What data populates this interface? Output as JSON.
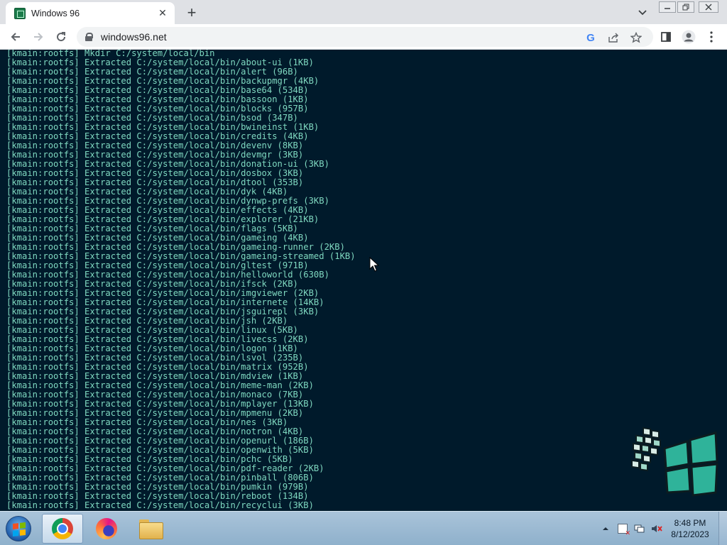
{
  "browser": {
    "tab": {
      "title": "Windows 96",
      "close": "✕"
    },
    "new_tab": "+",
    "address": {
      "url": "windows96.net"
    }
  },
  "terminal": {
    "colors": {
      "background": "#001a2b",
      "text": "#7fd8c0"
    },
    "lines": [
      "[kmain:rootfs] Mkdir C:/system/local/bin",
      "[kmain:rootfs] Extracted C:/system/local/bin/about-ui (1KB)",
      "[kmain:rootfs] Extracted C:/system/local/bin/alert (96B)",
      "[kmain:rootfs] Extracted C:/system/local/bin/backupmgr (4KB)",
      "[kmain:rootfs] Extracted C:/system/local/bin/base64 (534B)",
      "[kmain:rootfs] Extracted C:/system/local/bin/bassoon (1KB)",
      "[kmain:rootfs] Extracted C:/system/local/bin/blocks (957B)",
      "[kmain:rootfs] Extracted C:/system/local/bin/bsod (347B)",
      "[kmain:rootfs] Extracted C:/system/local/bin/bwineinst (1KB)",
      "[kmain:rootfs] Extracted C:/system/local/bin/credits (4KB)",
      "[kmain:rootfs] Extracted C:/system/local/bin/devenv (8KB)",
      "[kmain:rootfs] Extracted C:/system/local/bin/devmgr (3KB)",
      "[kmain:rootfs] Extracted C:/system/local/bin/donation-ui (3KB)",
      "[kmain:rootfs] Extracted C:/system/local/bin/dosbox (3KB)",
      "[kmain:rootfs] Extracted C:/system/local/bin/dtool (353B)",
      "[kmain:rootfs] Extracted C:/system/local/bin/dyk (4KB)",
      "[kmain:rootfs] Extracted C:/system/local/bin/dynwp-prefs (3KB)",
      "[kmain:rootfs] Extracted C:/system/local/bin/effects (4KB)",
      "[kmain:rootfs] Extracted C:/system/local/bin/explorer (21KB)",
      "[kmain:rootfs] Extracted C:/system/local/bin/flags (5KB)",
      "[kmain:rootfs] Extracted C:/system/local/bin/gameing (4KB)",
      "[kmain:rootfs] Extracted C:/system/local/bin/gameing-runner (2KB)",
      "[kmain:rootfs] Extracted C:/system/local/bin/gameing-streamed (1KB)",
      "[kmain:rootfs] Extracted C:/system/local/bin/gltest (971B)",
      "[kmain:rootfs] Extracted C:/system/local/bin/helloworld (630B)",
      "[kmain:rootfs] Extracted C:/system/local/bin/ifsck (2KB)",
      "[kmain:rootfs] Extracted C:/system/local/bin/imgviewer (2KB)",
      "[kmain:rootfs] Extracted C:/system/local/bin/internete (14KB)",
      "[kmain:rootfs] Extracted C:/system/local/bin/jsguirepl (3KB)",
      "[kmain:rootfs] Extracted C:/system/local/bin/jsh (2KB)",
      "[kmain:rootfs] Extracted C:/system/local/bin/linux (5KB)",
      "[kmain:rootfs] Extracted C:/system/local/bin/livecss (2KB)",
      "[kmain:rootfs] Extracted C:/system/local/bin/logon (1KB)",
      "[kmain:rootfs] Extracted C:/system/local/bin/lsvol (235B)",
      "[kmain:rootfs] Extracted C:/system/local/bin/matrix (952B)",
      "[kmain:rootfs] Extracted C:/system/local/bin/mdview (1KB)",
      "[kmain:rootfs] Extracted C:/system/local/bin/meme-man (2KB)",
      "[kmain:rootfs] Extracted C:/system/local/bin/monaco (7KB)",
      "[kmain:rootfs] Extracted C:/system/local/bin/mplayer (13KB)",
      "[kmain:rootfs] Extracted C:/system/local/bin/mpmenu (2KB)",
      "[kmain:rootfs] Extracted C:/system/local/bin/nes (3KB)",
      "[kmain:rootfs] Extracted C:/system/local/bin/notron (4KB)",
      "[kmain:rootfs] Extracted C:/system/local/bin/openurl (186B)",
      "[kmain:rootfs] Extracted C:/system/local/bin/openwith (5KB)",
      "[kmain:rootfs] Extracted C:/system/local/bin/pchc (5KB)",
      "[kmain:rootfs] Extracted C:/system/local/bin/pdf-reader (2KB)",
      "[kmain:rootfs] Extracted C:/system/local/bin/pinball (806B)",
      "[kmain:rootfs] Extracted C:/system/local/bin/pumkin (979B)",
      "[kmain:rootfs] Extracted C:/system/local/bin/reboot (134B)",
      "[kmain:rootfs] Extracted C:/system/local/bin/recyclui (3KB)"
    ]
  },
  "taskbar": {
    "apps": [
      "start-button",
      "chrome",
      "firefox",
      "file-explorer"
    ],
    "clock": {
      "time": "8:48 PM",
      "date": "8/12/2023"
    }
  }
}
